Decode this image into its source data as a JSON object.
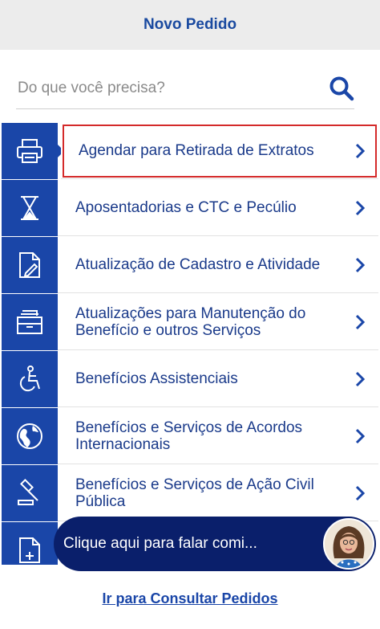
{
  "header": {
    "title": "Novo Pedido"
  },
  "search": {
    "placeholder": "Do que você precisa?",
    "value": ""
  },
  "services": [
    {
      "label": "Agendar para Retirada de Extratos",
      "icon": "printer-icon",
      "selected": true
    },
    {
      "label": "Aposentadorias e CTC e Pecúlio",
      "icon": "hourglass-icon",
      "selected": false
    },
    {
      "label": "Atualização de Cadastro e Atividade",
      "icon": "document-edit-icon",
      "selected": false
    },
    {
      "label": "Atualizações para Manutenção do Benefício e outros Serviços",
      "icon": "archive-box-icon",
      "selected": false
    },
    {
      "label": "Benefícios Assistenciais",
      "icon": "wheelchair-icon",
      "selected": false
    },
    {
      "label": "Benefícios e Serviços de Acordos Internacionais",
      "icon": "globe-icon",
      "selected": false
    },
    {
      "label": "Benefícios e Serviços de Ação Civil Pública",
      "icon": "gavel-icon",
      "selected": false
    },
    {
      "label": "",
      "icon": "document-add-icon",
      "selected": false
    }
  ],
  "chat": {
    "text": "Clique aqui para falar comi..."
  },
  "footer": {
    "link": "Ir para Consultar Pedidos"
  },
  "colors": {
    "primary": "#1a46a8",
    "chat_bg": "#0a1f6b",
    "highlight": "#d42a2a",
    "header_bg": "#ececec"
  }
}
